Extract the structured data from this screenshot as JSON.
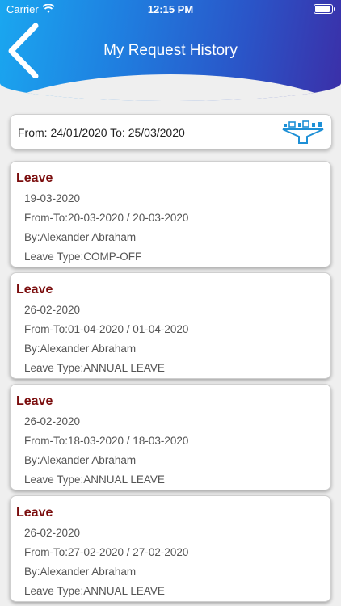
{
  "status_bar": {
    "carrier": "Carrier",
    "time": "12:15 PM"
  },
  "header": {
    "title": "My Request History"
  },
  "filter": {
    "text": "From: 24/01/2020 To: 25/03/2020"
  },
  "requests": [
    {
      "type": "Leave",
      "date": "19-03-2020",
      "from_to": "From-To:20-03-2020 / 20-03-2020",
      "by": "By:Alexander Abraham",
      "leave_type": "Leave Type:COMP-OFF"
    },
    {
      "type": "Leave",
      "date": "26-02-2020",
      "from_to": "From-To:01-04-2020 / 01-04-2020",
      "by": "By:Alexander Abraham",
      "leave_type": "Leave Type:ANNUAL LEAVE"
    },
    {
      "type": "Leave",
      "date": "26-02-2020",
      "from_to": "From-To:18-03-2020 / 18-03-2020",
      "by": "By:Alexander Abraham",
      "leave_type": "Leave Type:ANNUAL LEAVE"
    },
    {
      "type": "Leave",
      "date": "26-02-2020",
      "from_to": "From-To:27-02-2020 / 27-02-2020",
      "by": "By:Alexander Abraham",
      "leave_type": "Leave Type:ANNUAL LEAVE"
    }
  ],
  "colors": {
    "header_start": "#1aa7f0",
    "header_end": "#3b2fa8",
    "card_title": "#7a0c0c",
    "filter_icon": "#1e90d6"
  },
  "icons": {
    "back": "chevron-left-icon",
    "filter": "filter-funnel-icon"
  }
}
